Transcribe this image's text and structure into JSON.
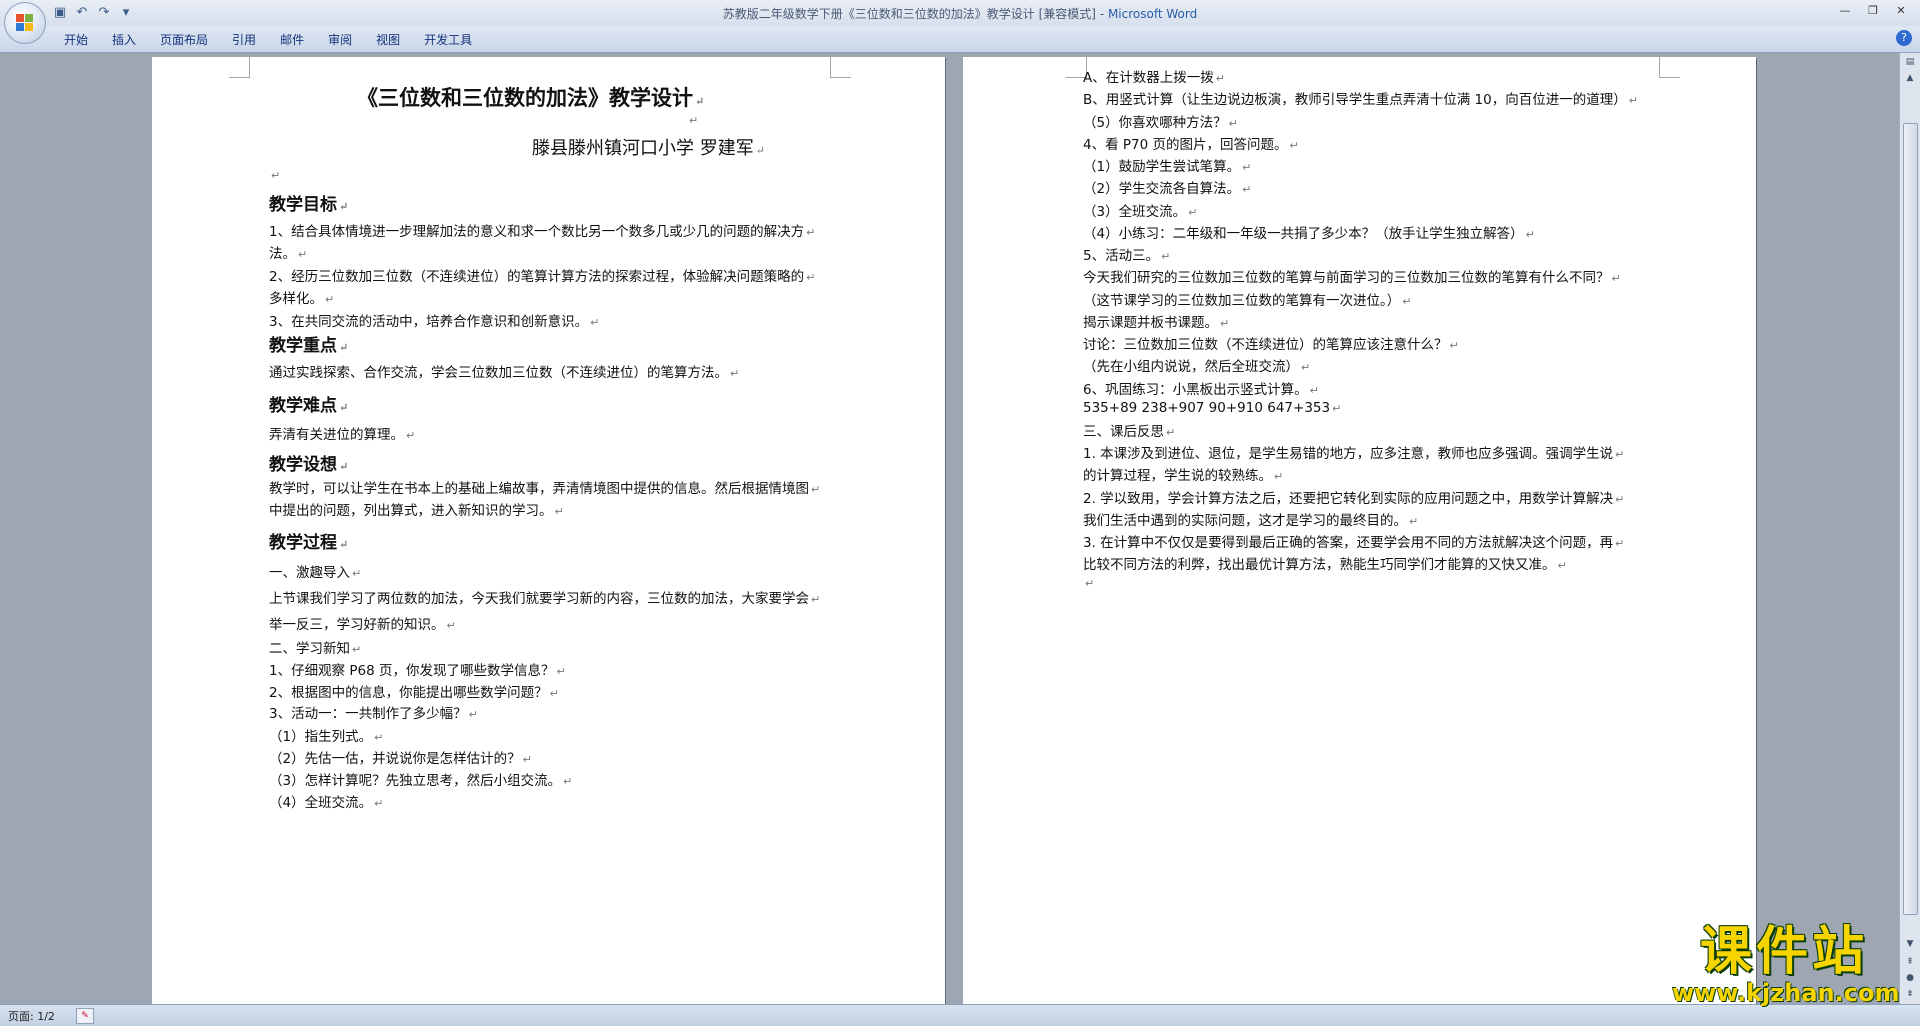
{
  "window": {
    "title": "苏教版二年级数学下册《三位数和三位数的加法》教学设计 [兼容模式]",
    "title_separator": " - ",
    "app_name": "Microsoft Word"
  },
  "quick_access": [
    "save-icon",
    "undo-icon",
    "redo-icon",
    "customize-icon"
  ],
  "ribbon_tabs": [
    "开始",
    "插入",
    "页面布局",
    "引用",
    "邮件",
    "审阅",
    "视图",
    "开发工具"
  ],
  "page1": [
    "《三位数和三位数的加法》教学设计",
    "",
    "滕县滕州镇河口小学     罗建军",
    "",
    "教学目标",
    "1、结合具体情境进一步理解加法的意义和求一个数比另一个数多几或少几的问题的解决方",
    "法。",
    "2、经历三位数加三位数（不连续进位）的笔算计算方法的探索过程，体验解决问题策略的",
    "多样化。",
    "3、在共同交流的活动中，培养合作意识和创新意识。",
    "教学重点",
    "通过实践探索、合作交流，学会三位数加三位数（不连续进位）的笔算方法。",
    "教学难点",
    "弄清有关进位的算理。",
    "教学设想",
    "教学时，可以让学生在书本上的基础上编故事，弄清情境图中提供的信息。然后根据情境图",
    "中提出的问题，列出算式，进入新知识的学习。",
    "教学过程",
    "一、激趣导入",
    "上节课我们学习了两位数的加法，今天我们就要学习新的内容，三位数的加法，大家要学会",
    "举一反三，学习好新的知识。",
    "二、学习新知",
    "1、仔细观察 P68 页，你发现了哪些数学信息？",
    "2、根据图中的信息，你能提出哪些数学问题？",
    "3、活动一：一共制作了多少幅？",
    "（1）指生列式。",
    "（2）先估一估，并说说你是怎样估计的？",
    "（3）怎样计算呢？先独立思考，然后小组交流。",
    "（4）全班交流。"
  ],
  "page2": [
    "A、在计数器上拨一拨",
    "B、用竖式计算（让生边说边板演，教师引导学生重点弄清十位满 10，向百位进一的道理）",
    "（5）你喜欢哪种方法？",
    "4、看 P70 页的图片，回答问题。",
    "（1）鼓励学生尝试笔算。",
    "（2）学生交流各自算法。",
    "（3）全班交流。",
    "（4）小练习：二年级和一年级一共捐了多少本？（放手让学生独立解答）",
    "5、活动三。",
    "今天我们研究的三位数加三位数的笔算与前面学习的三位数加三位数的笔算有什么不同？",
    "（这节课学习的三位数加三位数的笔算有一次进位。）",
    "揭示课题并板书课题。",
    "讨论：三位数加三位数（不连续进位）的笔算应该注意什么？",
    "（先在小组内说说，然后全班交流）",
    "6、巩固练习：小黑板出示竖式计算。",
    "535+89    238+907    90+910      647+353",
    "三、课后反思",
    "1.    本课涉及到进位、退位，是学生易错的地方，应多注意，教师也应多强调。强调学生说",
    "的计算过程，学生说的较熟练。",
    "2.    学以致用，学会计算方法之后，还要把它转化到实际的应用问题之中，用数学计算解决",
    "我们生活中遇到的实际问题，这才是学习的最终目的。",
    "3.    在计算中不仅仅是要得到最后正确的答案，还要学会用不同的方法就解决这个问题，再",
    "比较不同方法的利弊，找出最优计算方法，熟能生巧同学们才能算的又快又准。",
    ""
  ],
  "paragraph_mark": "↵",
  "status": {
    "page_label": "页面: 1/2"
  },
  "watermark": {
    "line1": "课件站",
    "line2": "www.kjzhan.com"
  }
}
